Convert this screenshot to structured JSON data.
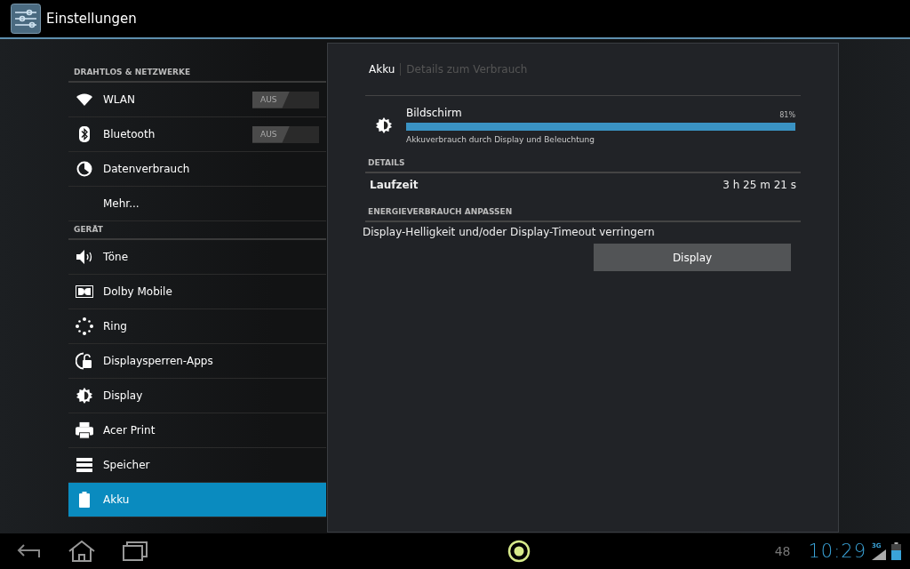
{
  "action_bar": {
    "title": "Einstellungen"
  },
  "sidebar": {
    "items": [
      {
        "kind": "header",
        "label": "DRAHTLOS & NETZWERKE"
      },
      {
        "kind": "item",
        "label": "WLAN",
        "selected": false,
        "toggle": {
          "label": "AUS",
          "on": false
        }
      },
      {
        "kind": "item",
        "label": "Bluetooth",
        "selected": false,
        "toggle": {
          "label": "AUS",
          "on": false
        }
      },
      {
        "kind": "item",
        "label": "Datenverbrauch",
        "selected": false
      },
      {
        "kind": "item",
        "label": "Mehr...",
        "selected": false
      },
      {
        "kind": "header",
        "label": "GERÄT"
      },
      {
        "kind": "item",
        "label": "Töne",
        "selected": false
      },
      {
        "kind": "item",
        "label": "Dolby Mobile",
        "selected": false
      },
      {
        "kind": "item",
        "label": "Ring",
        "selected": false
      },
      {
        "kind": "item",
        "label": "Displaysperren-Apps",
        "selected": false
      },
      {
        "kind": "item",
        "label": "Display",
        "selected": false
      },
      {
        "kind": "item",
        "label": "Acer Print",
        "selected": false
      },
      {
        "kind": "item",
        "label": "Speicher",
        "selected": false
      },
      {
        "kind": "item",
        "label": "Akku",
        "selected": true
      }
    ]
  },
  "detail": {
    "breadcrumb": {
      "title": "Akku",
      "subtitle": "Details zum Verbrauch"
    },
    "usage": {
      "name": "Bildschirm",
      "percent": "81%",
      "level": 1.0,
      "description": "Akkuverbrauch durch Display und Beleuchtung"
    },
    "details_header": "DETAILS",
    "runtime": {
      "label": "Laufzeit",
      "value": "3 h 25 m 21 s"
    },
    "adjust_header": "ENERGIEVERBRAUCH ANPASSEN",
    "adjust_text": "Display-Helligkeit und/oder Display-Timeout verringern",
    "button": "Display"
  },
  "system_bar": {
    "notification_count": "48",
    "time": "10:29",
    "network": "3G"
  }
}
